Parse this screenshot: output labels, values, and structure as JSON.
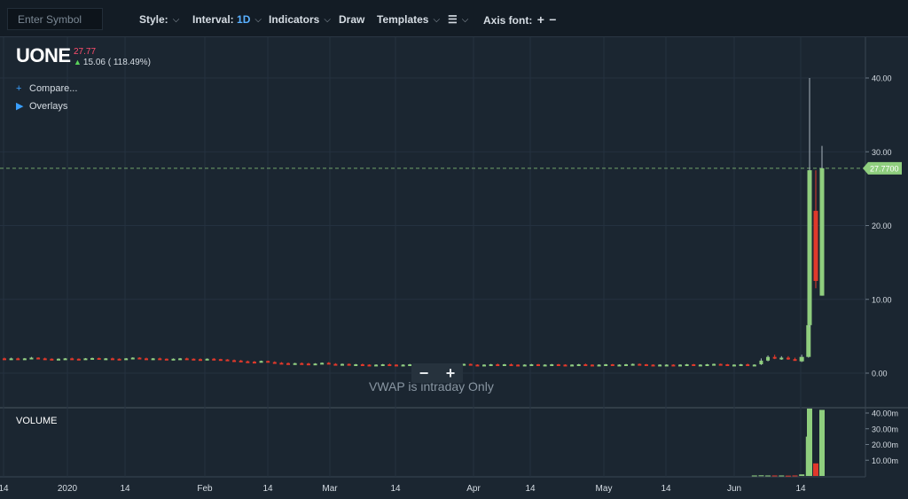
{
  "toolbar": {
    "symbol_placeholder": "Enter Symbol",
    "style_label": "Style:",
    "interval_label": "Interval:",
    "interval_value": "1D",
    "indicators_label": "Indicators",
    "draw_label": "Draw",
    "templates_label": "Templates",
    "axis_font_label": "Axis font:",
    "increase_glyph": "+",
    "decrease_glyph": "−",
    "chevron_glyph": "⌵",
    "menu_glyph": "☰"
  },
  "quote": {
    "ticker": "UONE",
    "last": "27.77",
    "change": "15.06 ( 118.49%)",
    "up_glyph": "▲"
  },
  "sidebar": {
    "compare_mark": "+",
    "compare_label": "Compare...",
    "overlays_mark": "▶",
    "overlays_label": "Overlays"
  },
  "zoom": {
    "out_label": "−",
    "in_label": "+"
  },
  "notice": "VWAP is intraday Only",
  "volume_label": "VOLUME",
  "colors": {
    "background": "#1b2631",
    "grid": "#243140",
    "up_candle": "#8fce7e",
    "down_candle": "#e0392b",
    "last_price_line": "#8fce7e",
    "axis_text": "#d6dde4"
  },
  "chart_data": {
    "type": "candlestick",
    "symbol": "UONE",
    "interval": "1D",
    "price_axis": {
      "ticks": [
        "0.00",
        "10.00",
        "20.00",
        "30.00",
        "40.00"
      ],
      "range": [
        0,
        40
      ],
      "last_price_label": "27.7700"
    },
    "volume_axis": {
      "ticks": [
        "10.00m",
        "20.00m",
        "30.00m",
        "40.00m"
      ],
      "range": [
        0,
        40
      ]
    },
    "x_axis_ticks": [
      "14",
      "2020",
      "14",
      "Feb",
      "14",
      "Mar",
      "14",
      "Apr",
      "14",
      "May",
      "14",
      "Jun",
      "14"
    ],
    "last_price": 27.77,
    "grid": true,
    "candles": [
      {
        "o": 2.0,
        "h": 2.1,
        "l": 1.9,
        "c": 1.95
      },
      {
        "o": 1.95,
        "h": 2.1,
        "l": 1.9,
        "c": 2.0
      },
      {
        "o": 2.0,
        "h": 2.1,
        "l": 1.85,
        "c": 1.9
      },
      {
        "o": 1.9,
        "h": 2.05,
        "l": 1.85,
        "c": 2.0
      },
      {
        "o": 2.0,
        "h": 2.2,
        "l": 1.95,
        "c": 2.1
      },
      {
        "o": 2.1,
        "h": 2.15,
        "l": 1.95,
        "c": 2.0
      },
      {
        "o": 2.0,
        "h": 2.1,
        "l": 1.9,
        "c": 1.95
      },
      {
        "o": 1.95,
        "h": 2.0,
        "l": 1.85,
        "c": 1.9
      },
      {
        "o": 1.9,
        "h": 2.0,
        "l": 1.85,
        "c": 1.95
      },
      {
        "o": 1.95,
        "h": 2.05,
        "l": 1.9,
        "c": 2.0
      },
      {
        "o": 2.0,
        "h": 2.1,
        "l": 1.9,
        "c": 1.95
      },
      {
        "o": 1.95,
        "h": 2.0,
        "l": 1.85,
        "c": 1.9
      },
      {
        "o": 1.9,
        "h": 2.05,
        "l": 1.85,
        "c": 2.0
      },
      {
        "o": 2.0,
        "h": 2.1,
        "l": 1.95,
        "c": 2.05
      },
      {
        "o": 2.05,
        "h": 2.1,
        "l": 1.9,
        "c": 1.95
      },
      {
        "o": 1.95,
        "h": 2.05,
        "l": 1.9,
        "c": 2.0
      },
      {
        "o": 2.0,
        "h": 2.1,
        "l": 1.9,
        "c": 1.95
      },
      {
        "o": 1.95,
        "h": 2.0,
        "l": 1.85,
        "c": 1.9
      },
      {
        "o": 1.9,
        "h": 2.05,
        "l": 1.85,
        "c": 2.0
      },
      {
        "o": 2.0,
        "h": 2.15,
        "l": 1.95,
        "c": 2.1
      },
      {
        "o": 2.1,
        "h": 2.15,
        "l": 1.95,
        "c": 2.0
      },
      {
        "o": 2.0,
        "h": 2.1,
        "l": 1.9,
        "c": 1.95
      },
      {
        "o": 1.95,
        "h": 2.05,
        "l": 1.9,
        "c": 2.0
      },
      {
        "o": 2.0,
        "h": 2.1,
        "l": 1.9,
        "c": 1.95
      },
      {
        "o": 1.95,
        "h": 2.0,
        "l": 1.85,
        "c": 1.9
      },
      {
        "o": 1.9,
        "h": 2.0,
        "l": 1.85,
        "c": 1.95
      },
      {
        "o": 1.95,
        "h": 2.05,
        "l": 1.9,
        "c": 2.0
      },
      {
        "o": 2.0,
        "h": 2.1,
        "l": 1.9,
        "c": 1.95
      },
      {
        "o": 1.95,
        "h": 2.0,
        "l": 1.85,
        "c": 1.9
      },
      {
        "o": 1.9,
        "h": 2.0,
        "l": 1.8,
        "c": 1.85
      },
      {
        "o": 1.85,
        "h": 2.0,
        "l": 1.8,
        "c": 1.95
      },
      {
        "o": 1.95,
        "h": 2.05,
        "l": 1.85,
        "c": 1.9
      },
      {
        "o": 1.9,
        "h": 1.95,
        "l": 1.8,
        "c": 1.85
      },
      {
        "o": 1.85,
        "h": 1.9,
        "l": 1.7,
        "c": 1.75
      },
      {
        "o": 1.75,
        "h": 1.85,
        "l": 1.65,
        "c": 1.7
      },
      {
        "o": 1.7,
        "h": 1.8,
        "l": 1.55,
        "c": 1.6
      },
      {
        "o": 1.6,
        "h": 1.7,
        "l": 1.5,
        "c": 1.55
      },
      {
        "o": 1.55,
        "h": 1.65,
        "l": 1.4,
        "c": 1.5
      },
      {
        "o": 1.5,
        "h": 1.7,
        "l": 1.45,
        "c": 1.65
      },
      {
        "o": 1.65,
        "h": 1.7,
        "l": 1.45,
        "c": 1.5
      },
      {
        "o": 1.5,
        "h": 1.6,
        "l": 1.35,
        "c": 1.4
      },
      {
        "o": 1.4,
        "h": 1.5,
        "l": 1.3,
        "c": 1.35
      },
      {
        "o": 1.35,
        "h": 1.45,
        "l": 1.25,
        "c": 1.3
      },
      {
        "o": 1.3,
        "h": 1.4,
        "l": 1.25,
        "c": 1.35
      },
      {
        "o": 1.35,
        "h": 1.45,
        "l": 1.25,
        "c": 1.3
      },
      {
        "o": 1.3,
        "h": 1.4,
        "l": 1.2,
        "c": 1.25
      },
      {
        "o": 1.25,
        "h": 1.35,
        "l": 1.2,
        "c": 1.3
      },
      {
        "o": 1.3,
        "h": 1.45,
        "l": 1.25,
        "c": 1.4
      },
      {
        "o": 1.4,
        "h": 1.5,
        "l": 1.2,
        "c": 1.25
      },
      {
        "o": 1.25,
        "h": 1.35,
        "l": 1.15,
        "c": 1.2
      },
      {
        "o": 1.2,
        "h": 1.3,
        "l": 1.1,
        "c": 1.25
      },
      {
        "o": 1.25,
        "h": 1.3,
        "l": 1.1,
        "c": 1.15
      },
      {
        "o": 1.15,
        "h": 1.25,
        "l": 1.1,
        "c": 1.2
      },
      {
        "o": 1.2,
        "h": 1.3,
        "l": 1.1,
        "c": 1.15
      },
      {
        "o": 1.15,
        "h": 1.2,
        "l": 1.05,
        "c": 1.1
      },
      {
        "o": 1.1,
        "h": 1.2,
        "l": 1.05,
        "c": 1.15
      },
      {
        "o": 1.15,
        "h": 1.25,
        "l": 1.1,
        "c": 1.2
      },
      {
        "o": 1.2,
        "h": 1.3,
        "l": 1.1,
        "c": 1.15
      },
      {
        "o": 1.15,
        "h": 1.2,
        "l": 1.05,
        "c": 1.1
      },
      {
        "o": 1.1,
        "h": 1.2,
        "l": 1.05,
        "c": 1.15
      },
      {
        "o": 1.15,
        "h": 1.25,
        "l": 1.1,
        "c": 1.2
      },
      {
        "o": 1.2,
        "h": 1.3,
        "l": 1.1,
        "c": 1.15
      },
      {
        "o": 1.15,
        "h": 1.2,
        "l": 1.1,
        "c": 1.15
      },
      {
        "o": 1.15,
        "h": 1.25,
        "l": 1.1,
        "c": 1.2
      },
      {
        "o": 1.2,
        "h": 1.25,
        "l": 1.1,
        "c": 1.15
      },
      {
        "o": 1.15,
        "h": 1.2,
        "l": 1.05,
        "c": 1.1
      },
      {
        "o": 1.1,
        "h": 1.2,
        "l": 1.05,
        "c": 1.15
      },
      {
        "o": 1.15,
        "h": 1.25,
        "l": 1.1,
        "c": 1.2
      },
      {
        "o": 1.2,
        "h": 1.3,
        "l": 1.15,
        "c": 1.25
      },
      {
        "o": 1.25,
        "h": 1.3,
        "l": 1.1,
        "c": 1.15
      },
      {
        "o": 1.15,
        "h": 1.2,
        "l": 1.05,
        "c": 1.1
      },
      {
        "o": 1.1,
        "h": 1.2,
        "l": 1.05,
        "c": 1.15
      },
      {
        "o": 1.15,
        "h": 1.25,
        "l": 1.1,
        "c": 1.2
      },
      {
        "o": 1.2,
        "h": 1.3,
        "l": 1.1,
        "c": 1.15
      },
      {
        "o": 1.15,
        "h": 1.25,
        "l": 1.1,
        "c": 1.2
      },
      {
        "o": 1.2,
        "h": 1.3,
        "l": 1.1,
        "c": 1.15
      },
      {
        "o": 1.15,
        "h": 1.2,
        "l": 1.05,
        "c": 1.1
      },
      {
        "o": 1.1,
        "h": 1.2,
        "l": 1.05,
        "c": 1.15
      },
      {
        "o": 1.15,
        "h": 1.25,
        "l": 1.1,
        "c": 1.2
      },
      {
        "o": 1.2,
        "h": 1.25,
        "l": 1.1,
        "c": 1.15
      },
      {
        "o": 1.15,
        "h": 1.2,
        "l": 1.1,
        "c": 1.15
      },
      {
        "o": 1.15,
        "h": 1.25,
        "l": 1.1,
        "c": 1.2
      },
      {
        "o": 1.2,
        "h": 1.25,
        "l": 1.1,
        "c": 1.15
      },
      {
        "o": 1.15,
        "h": 1.2,
        "l": 1.05,
        "c": 1.1
      },
      {
        "o": 1.1,
        "h": 1.2,
        "l": 1.05,
        "c": 1.15
      },
      {
        "o": 1.15,
        "h": 1.25,
        "l": 1.1,
        "c": 1.2
      },
      {
        "o": 1.2,
        "h": 1.3,
        "l": 1.1,
        "c": 1.15
      },
      {
        "o": 1.15,
        "h": 1.2,
        "l": 1.05,
        "c": 1.1
      },
      {
        "o": 1.1,
        "h": 1.2,
        "l": 1.05,
        "c": 1.15
      },
      {
        "o": 1.15,
        "h": 1.25,
        "l": 1.1,
        "c": 1.2
      },
      {
        "o": 1.2,
        "h": 1.25,
        "l": 1.1,
        "c": 1.15
      },
      {
        "o": 1.15,
        "h": 1.2,
        "l": 1.1,
        "c": 1.15
      },
      {
        "o": 1.15,
        "h": 1.25,
        "l": 1.1,
        "c": 1.2
      },
      {
        "o": 1.2,
        "h": 1.3,
        "l": 1.15,
        "c": 1.25
      },
      {
        "o": 1.25,
        "h": 1.3,
        "l": 1.15,
        "c": 1.2
      },
      {
        "o": 1.2,
        "h": 1.25,
        "l": 1.1,
        "c": 1.15
      },
      {
        "o": 1.15,
        "h": 1.2,
        "l": 1.05,
        "c": 1.1
      },
      {
        "o": 1.1,
        "h": 1.2,
        "l": 1.05,
        "c": 1.15
      },
      {
        "o": 1.15,
        "h": 1.2,
        "l": 1.1,
        "c": 1.15
      },
      {
        "o": 1.15,
        "h": 1.2,
        "l": 1.05,
        "c": 1.1
      },
      {
        "o": 1.1,
        "h": 1.2,
        "l": 1.05,
        "c": 1.15
      },
      {
        "o": 1.15,
        "h": 1.25,
        "l": 1.1,
        "c": 1.2
      },
      {
        "o": 1.2,
        "h": 1.25,
        "l": 1.1,
        "c": 1.15
      },
      {
        "o": 1.15,
        "h": 1.2,
        "l": 1.1,
        "c": 1.15
      },
      {
        "o": 1.15,
        "h": 1.25,
        "l": 1.1,
        "c": 1.2
      },
      {
        "o": 1.2,
        "h": 1.3,
        "l": 1.15,
        "c": 1.25
      },
      {
        "o": 1.25,
        "h": 1.3,
        "l": 1.15,
        "c": 1.2
      },
      {
        "o": 1.2,
        "h": 1.25,
        "l": 1.1,
        "c": 1.15
      },
      {
        "o": 1.15,
        "h": 1.2,
        "l": 1.1,
        "c": 1.15
      },
      {
        "o": 1.15,
        "h": 1.25,
        "l": 1.1,
        "c": 1.2
      },
      {
        "o": 1.2,
        "h": 1.3,
        "l": 1.1,
        "c": 1.15
      },
      {
        "o": 1.15,
        "h": 1.2,
        "l": 1.1,
        "c": 1.15
      },
      {
        "o": 1.2,
        "h": 2.0,
        "l": 1.1,
        "c": 1.7
      },
      {
        "o": 1.7,
        "h": 2.4,
        "l": 1.6,
        "c": 2.2
      },
      {
        "o": 2.2,
        "h": 2.5,
        "l": 1.9,
        "c": 2.0
      },
      {
        "o": 2.0,
        "h": 2.3,
        "l": 1.8,
        "c": 2.1
      },
      {
        "o": 2.1,
        "h": 2.3,
        "l": 1.8,
        "c": 1.9
      },
      {
        "o": 1.9,
        "h": 2.1,
        "l": 1.7,
        "c": 1.8
      },
      {
        "o": 1.6,
        "h": 2.5,
        "l": 1.5,
        "c": 2.2
      },
      {
        "o": 2.2,
        "h": 8.5,
        "l": 2.1,
        "c": 6.5
      },
      {
        "o": 6.5,
        "h": 40.0,
        "l": 6.2,
        "c": 27.5
      },
      {
        "o": 22.0,
        "h": 27.5,
        "l": 11.5,
        "c": 12.5
      },
      {
        "o": 10.5,
        "h": 30.8,
        "l": 10.5,
        "c": 27.77
      }
    ],
    "volume_m": [
      0,
      0,
      0,
      0,
      0,
      0,
      0,
      0,
      0,
      0,
      0,
      0,
      0,
      0,
      0,
      0,
      0,
      0,
      0,
      0,
      0,
      0,
      0,
      0,
      0,
      0,
      0,
      0,
      0,
      0,
      0,
      0,
      0,
      0,
      0,
      0,
      0,
      0,
      0,
      0,
      0,
      0,
      0,
      0,
      0,
      0,
      0,
      0,
      0,
      0,
      0,
      0,
      0,
      0,
      0,
      0,
      0,
      0,
      0,
      0,
      0,
      0,
      0,
      0,
      0,
      0,
      0,
      0,
      0,
      0,
      0,
      0,
      0,
      0,
      0,
      0,
      0,
      0,
      0,
      0,
      0,
      0,
      0,
      0,
      0,
      0,
      0,
      0,
      0,
      0,
      0,
      0,
      0,
      0,
      0,
      0,
      0,
      0,
      0,
      0,
      0,
      0,
      0,
      0,
      0,
      0,
      0,
      0,
      0,
      0,
      0,
      0.3,
      0.4,
      0.3,
      0.3,
      0.3,
      0.2,
      0.3,
      1.0,
      25.0,
      44.0,
      8.0,
      42.0
    ]
  }
}
